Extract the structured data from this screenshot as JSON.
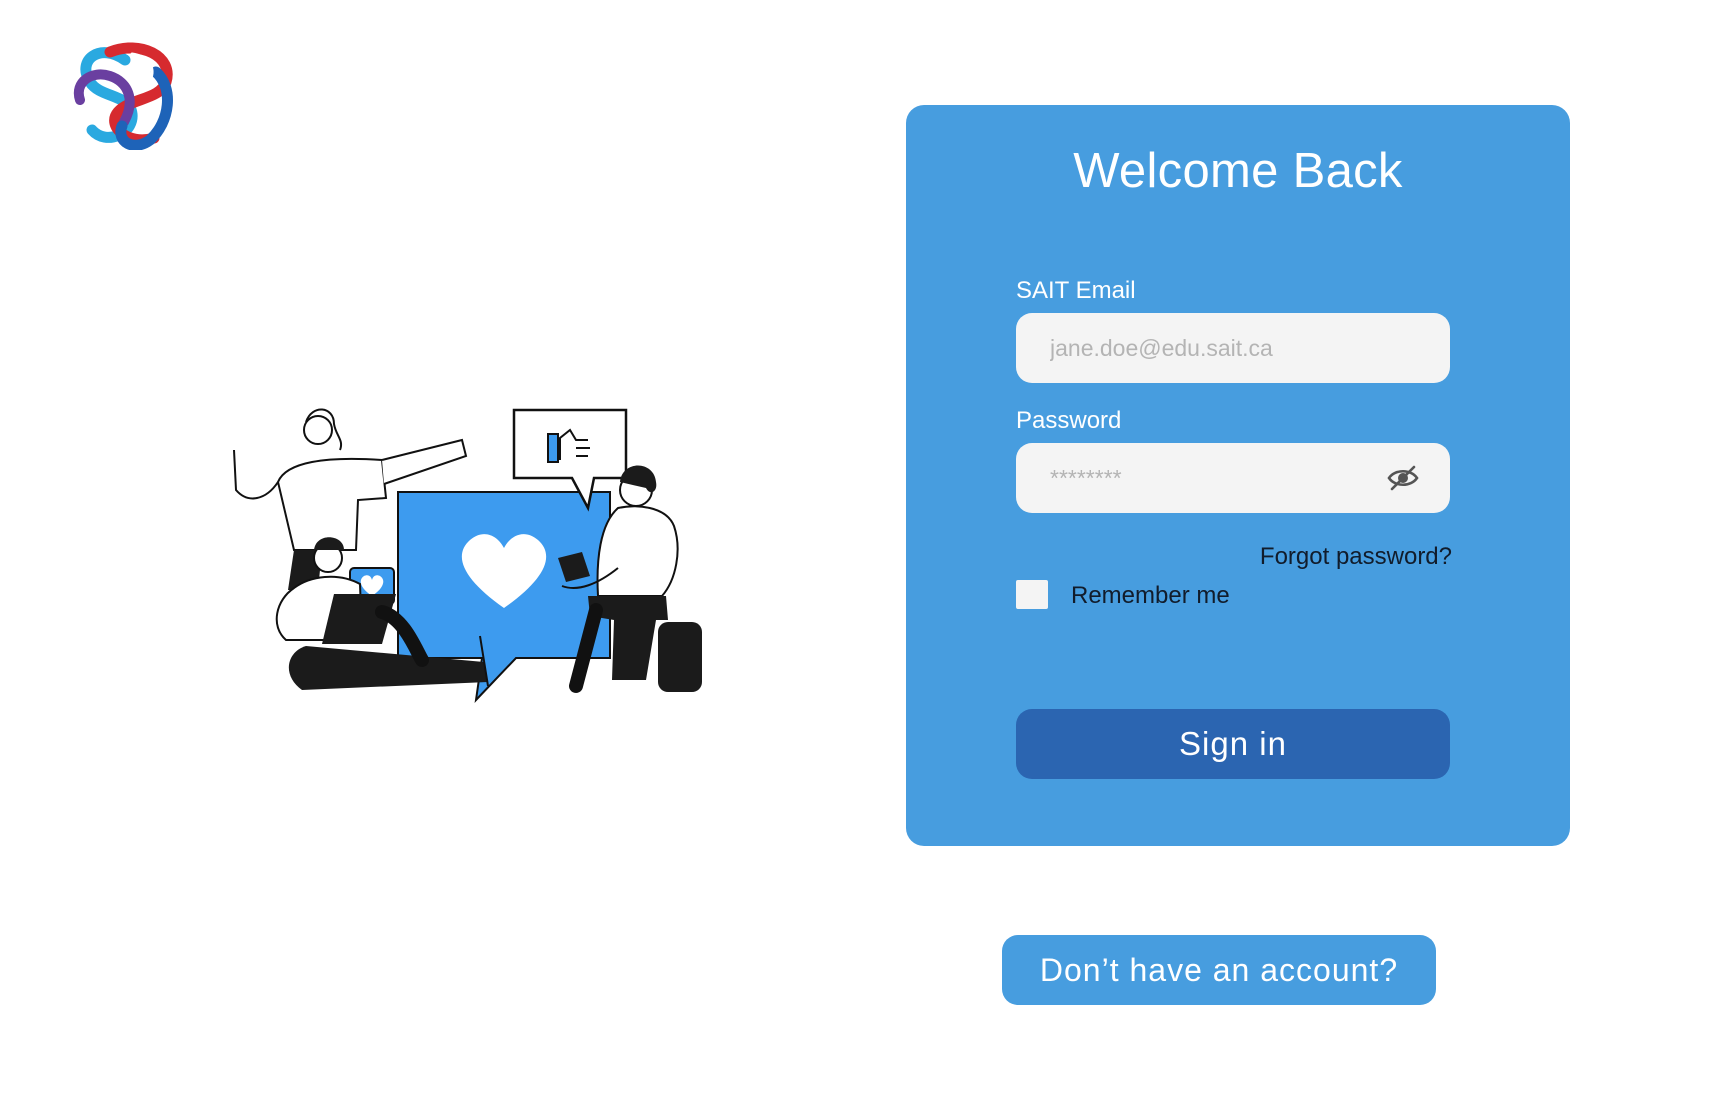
{
  "brand": {
    "logo_icon": "linked-loops-logo-icon",
    "colors": [
      "#2aa9e0",
      "#d62a2f",
      "#6a3fa0",
      "#1e63b8"
    ]
  },
  "illustration": {
    "icon": "people-social-media-illustration",
    "accent_color": "#3d9bef"
  },
  "login": {
    "title": "Welcome Back",
    "email_label": "SAIT Email",
    "email_placeholder": "jane.doe@edu.sait.ca",
    "password_label": "Password",
    "password_placeholder": "********",
    "toggle_visibility_icon": "eye-slash-icon",
    "forgot_password": "Forgot password?",
    "remember_me": "Remember me",
    "remember_me_checked": false,
    "signin_label": "Sign in"
  },
  "signup": {
    "label": "Don’t have an account?"
  },
  "colors": {
    "card_background": "#479ddf",
    "signin_button": "#2b65b1",
    "input_background": "#f4f4f4",
    "text_dark": "#111c2b"
  }
}
